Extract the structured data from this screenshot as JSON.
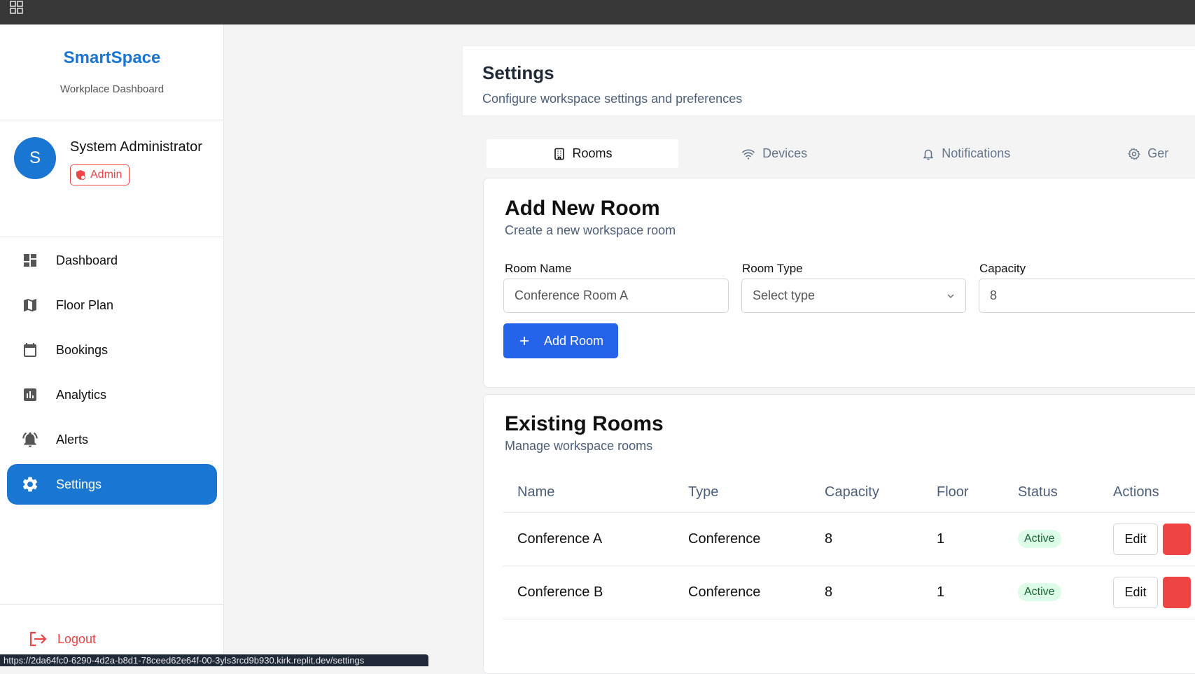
{
  "sidebar": {
    "brand_name": "SmartSpace",
    "brand_sub": "Workplace Dashboard",
    "user": {
      "initial": "S",
      "name": "System Administrator",
      "role": "Admin"
    },
    "items": [
      {
        "label": "Dashboard",
        "icon": "dashboard-icon"
      },
      {
        "label": "Floor Plan",
        "icon": "map-icon"
      },
      {
        "label": "Bookings",
        "icon": "calendar-icon"
      },
      {
        "label": "Analytics",
        "icon": "bar-chart-icon"
      },
      {
        "label": "Alerts",
        "icon": "alarm-bell-icon"
      },
      {
        "label": "Settings",
        "icon": "gear-icon"
      }
    ],
    "logout": "Logout"
  },
  "header": {
    "title": "Settings",
    "subtitle": "Configure workspace settings and preferences"
  },
  "tabs": [
    {
      "label": "Rooms",
      "icon": "building-icon"
    },
    {
      "label": "Devices",
      "icon": "wifi-icon"
    },
    {
      "label": "Notifications",
      "icon": "bell-icon"
    },
    {
      "label": "Ger",
      "icon": "gear-icon"
    }
  ],
  "add_room": {
    "title": "Add New Room",
    "subtitle": "Create a new workspace room",
    "name_label": "Room Name",
    "name_placeholder": "Conference Room A",
    "type_label": "Room Type",
    "type_placeholder": "Select type",
    "capacity_label": "Capacity",
    "capacity_value": "8",
    "button_label": "Add Room"
  },
  "existing": {
    "title": "Existing Rooms",
    "subtitle": "Manage workspace rooms",
    "columns": [
      "Name",
      "Type",
      "Capacity",
      "Floor",
      "Status",
      "Actions"
    ],
    "rows": [
      {
        "name": "Conference A",
        "type": "Conference",
        "capacity": "8",
        "floor": "1",
        "status": "Active",
        "edit": "Edit"
      },
      {
        "name": "Conference B",
        "type": "Conference",
        "capacity": "8",
        "floor": "1",
        "status": "Active",
        "edit": "Edit"
      }
    ]
  },
  "status_url": "https://2da64fc0-6290-4d2a-b8d1-78ceed62e64f-00-3yls3rcd9b930.kirk.replit.dev/settings",
  "colors": {
    "primary": "#1976d2",
    "button": "#2563eb",
    "danger": "#ef4444",
    "topbar": "#373737"
  }
}
